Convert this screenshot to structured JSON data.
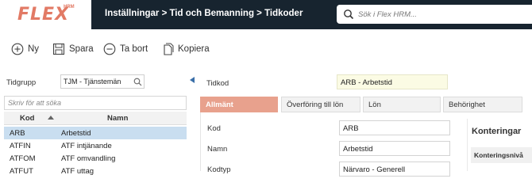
{
  "app": {
    "logo": "FLEX",
    "logo_sup": "HRM"
  },
  "header": {
    "breadcrumb": "Inställningar > Tid och Bemanning > Tidkoder",
    "search_placeholder": "Sök i Flex HRM..."
  },
  "toolbar": {
    "new_label": "Ny",
    "save_label": "Spara",
    "delete_label": "Ta bort",
    "copy_label": "Kopiera"
  },
  "left": {
    "tidgrupp_label": "Tidgrupp",
    "tidgrupp_value": "TJM - Tjänstemän",
    "filter_placeholder": "Skriv för att söka",
    "columns": {
      "kod": "Kod",
      "namn": "Namn"
    },
    "rows": [
      {
        "kod": "ARB",
        "namn": "Arbetstid"
      },
      {
        "kod": "ATFIN",
        "namn": "ATF intjänande"
      },
      {
        "kod": "ATFOM",
        "namn": "ATF omvandling"
      },
      {
        "kod": "ATFUT",
        "namn": "ATF uttag"
      }
    ]
  },
  "detail": {
    "tidkod_label": "Tidkod",
    "tidkod_value": "ARB - Arbetstid",
    "tabs": [
      "Allmänt",
      "Överföring till lön",
      "Lön",
      "Behörighet"
    ],
    "fields": [
      {
        "label": "Kod",
        "value": "ARB"
      },
      {
        "label": "Namn",
        "value": "Arbetstid"
      },
      {
        "label": "Kodtyp",
        "value": "Närvaro - Generell"
      }
    ],
    "konteringar_title": "Konteringar",
    "konteringsniva_label": "Konteringsnivå"
  }
}
